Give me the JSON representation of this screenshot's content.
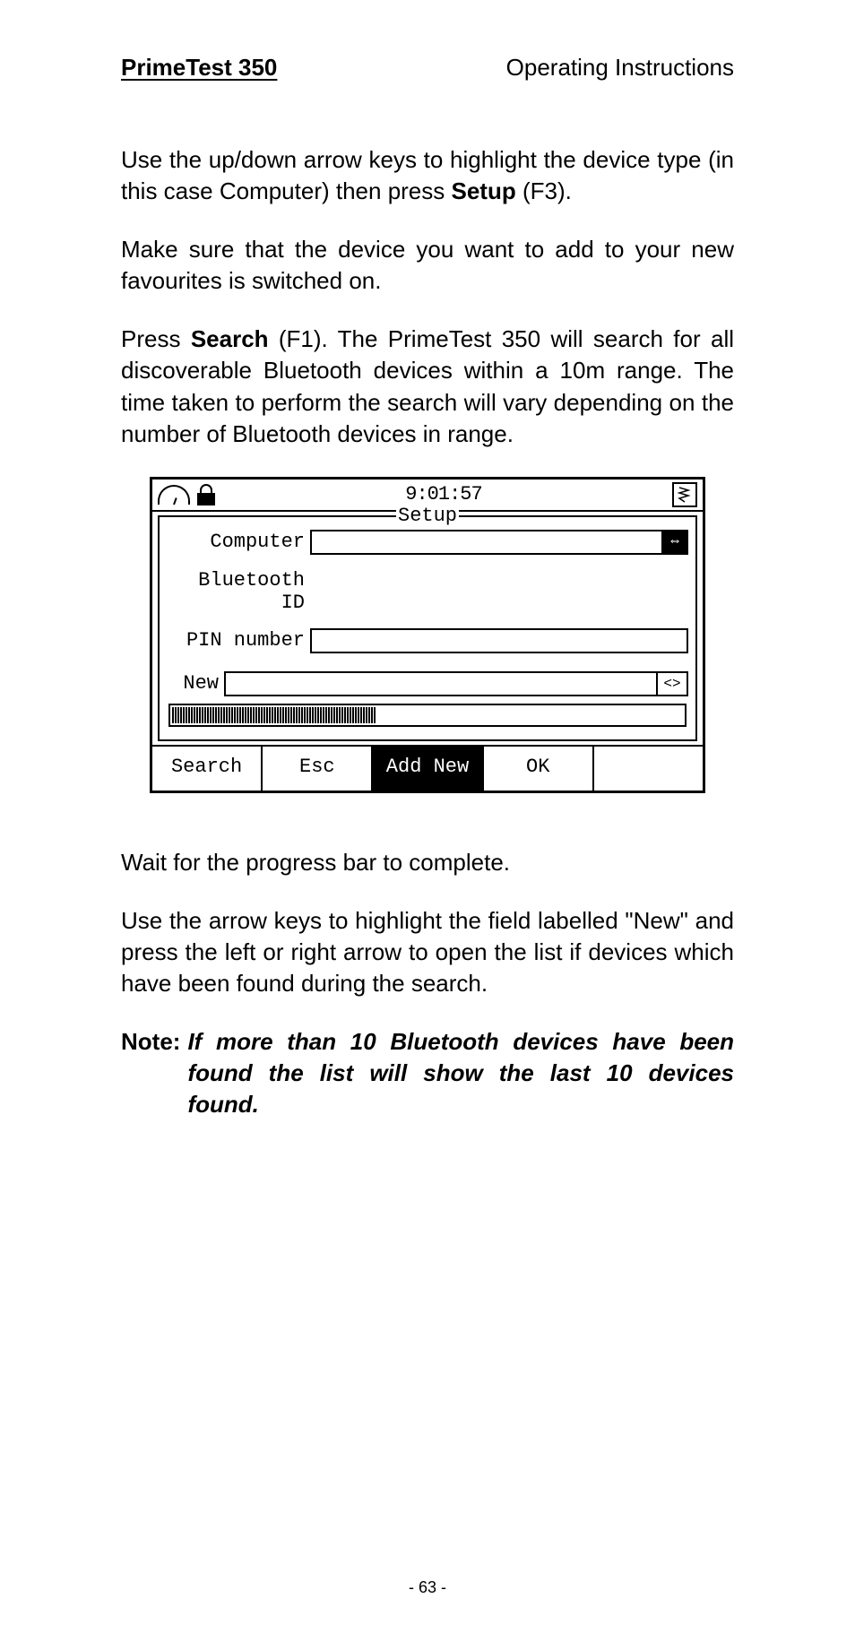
{
  "header": {
    "title": "PrimeTest 350",
    "subtitle": "Operating Instructions"
  },
  "paragraphs": {
    "p1_a": "Use the up/down arrow keys to highlight the device type (in this case Computer) then press ",
    "p1_bold": "Setup",
    "p1_b": " (F3).",
    "p2": "Make sure that the device you want to add to your new favourites is switched on.",
    "p3_a": "Press ",
    "p3_bold": "Search",
    "p3_b": " (F1). The PrimeTest 350 will search for all discoverable Bluetooth devices within a 10m range. The time taken to perform the search will vary depending on the number of Bluetooth devices in range.",
    "p4": "Wait for the progress bar to complete.",
    "p5": "Use the arrow keys to highlight the field labelled \"New\" and press the left or right arrow to open the list if devices which have been found during the search."
  },
  "note": {
    "label": "Note:",
    "text": "If more than 10 Bluetooth devices have been found the list will show the last 10 devices found."
  },
  "screen": {
    "time": "9:01:57",
    "frame_title": "Setup",
    "rows": {
      "computer": "Computer",
      "bluetooth": "Bluetooth ID",
      "pin": "PIN number",
      "new": "New"
    },
    "selector_active": "⇔",
    "selector_inactive": "<>",
    "softkeys": {
      "f1": "Search",
      "f2": "Esc",
      "f3": "Add New",
      "f4": "OK",
      "f5": ""
    }
  },
  "page_number": "- 63 -"
}
